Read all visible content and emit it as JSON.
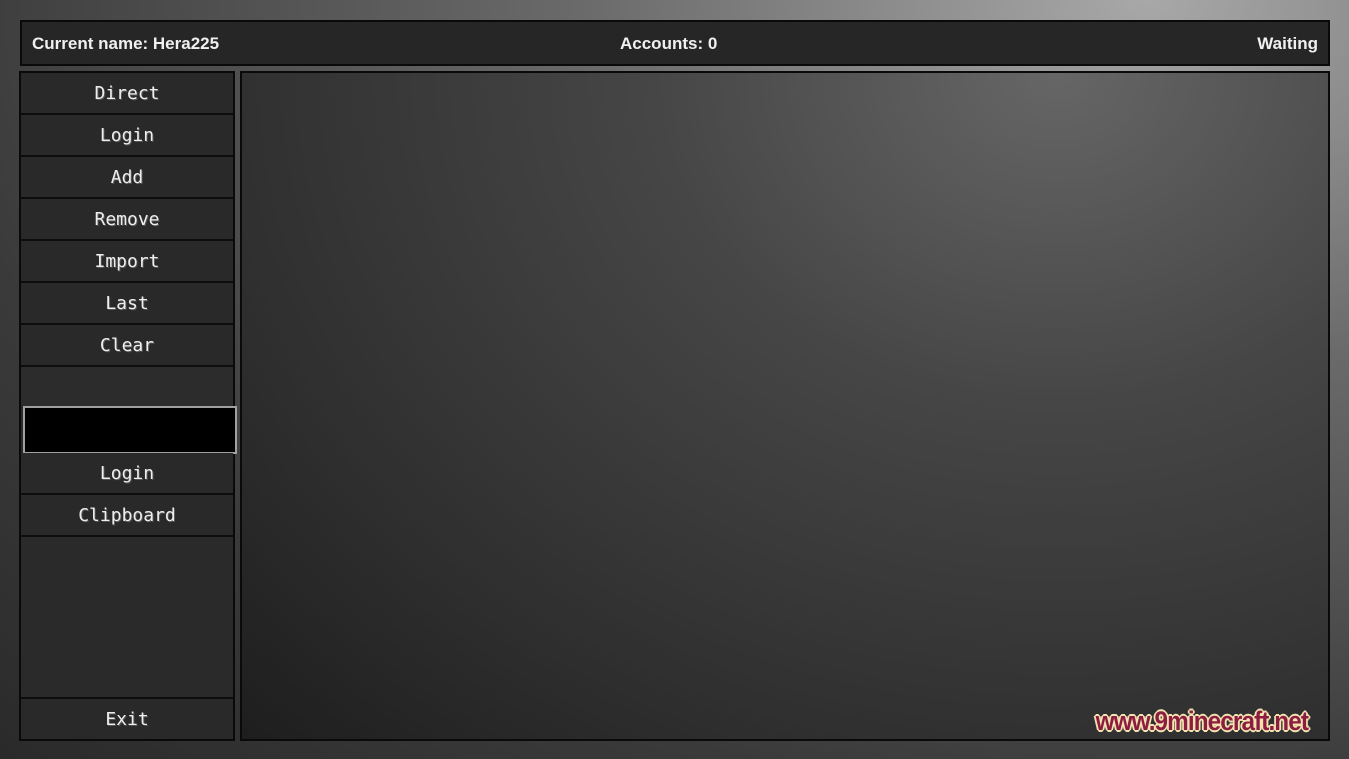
{
  "header": {
    "current_name": "Current name: Hera225",
    "accounts": "Accounts: 0",
    "status": "Waiting"
  },
  "sidebar": {
    "buttons": [
      "Direct",
      "Login",
      "Add",
      "Remove",
      "Import",
      "Last",
      "Clear"
    ],
    "direct_input": {
      "value": "",
      "placeholder": ""
    },
    "direct_buttons": [
      "Login",
      "Clipboard"
    ],
    "exit": "Exit"
  },
  "watermark": "www.9minecraft.net"
}
